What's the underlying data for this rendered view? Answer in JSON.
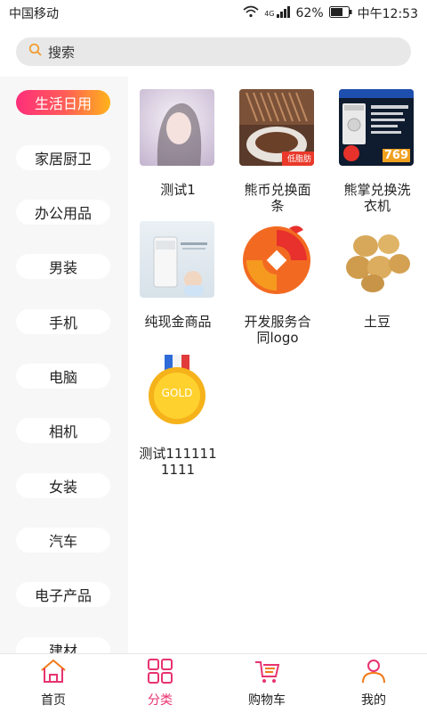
{
  "status": {
    "carrier": "中国移动",
    "battery": "62%",
    "time": "中午12:53",
    "network": "4G"
  },
  "search": {
    "placeholder": "搜索"
  },
  "sidebar": {
    "items": [
      {
        "label": "生活日用",
        "active": true
      },
      {
        "label": "家居厨卫"
      },
      {
        "label": "办公用品"
      },
      {
        "label": "男装"
      },
      {
        "label": "手机"
      },
      {
        "label": "电脑"
      },
      {
        "label": "相机"
      },
      {
        "label": "女装"
      },
      {
        "label": "汽车"
      },
      {
        "label": "电子产品"
      },
      {
        "label": "建材"
      }
    ]
  },
  "products": [
    {
      "name": "测试1"
    },
    {
      "name": "熊币兑换面条",
      "badge": "低脂肪"
    },
    {
      "name": "熊掌兑换洗衣机",
      "price_tag": "769"
    },
    {
      "name": "纯现金商品"
    },
    {
      "name": "开发服务合同logo"
    },
    {
      "name": "土豆"
    },
    {
      "name": "测试1111111111",
      "medal_text": "GOLD"
    }
  ],
  "tabbar": {
    "items": [
      {
        "label": "首页",
        "icon": "home-icon"
      },
      {
        "label": "分类",
        "icon": "category-icon",
        "active": true
      },
      {
        "label": "购物车",
        "icon": "cart-icon"
      },
      {
        "label": "我的",
        "icon": "user-icon"
      }
    ]
  },
  "colors": {
    "accent": "#e8336f",
    "sidebar_bg": "#f7f7f7"
  }
}
